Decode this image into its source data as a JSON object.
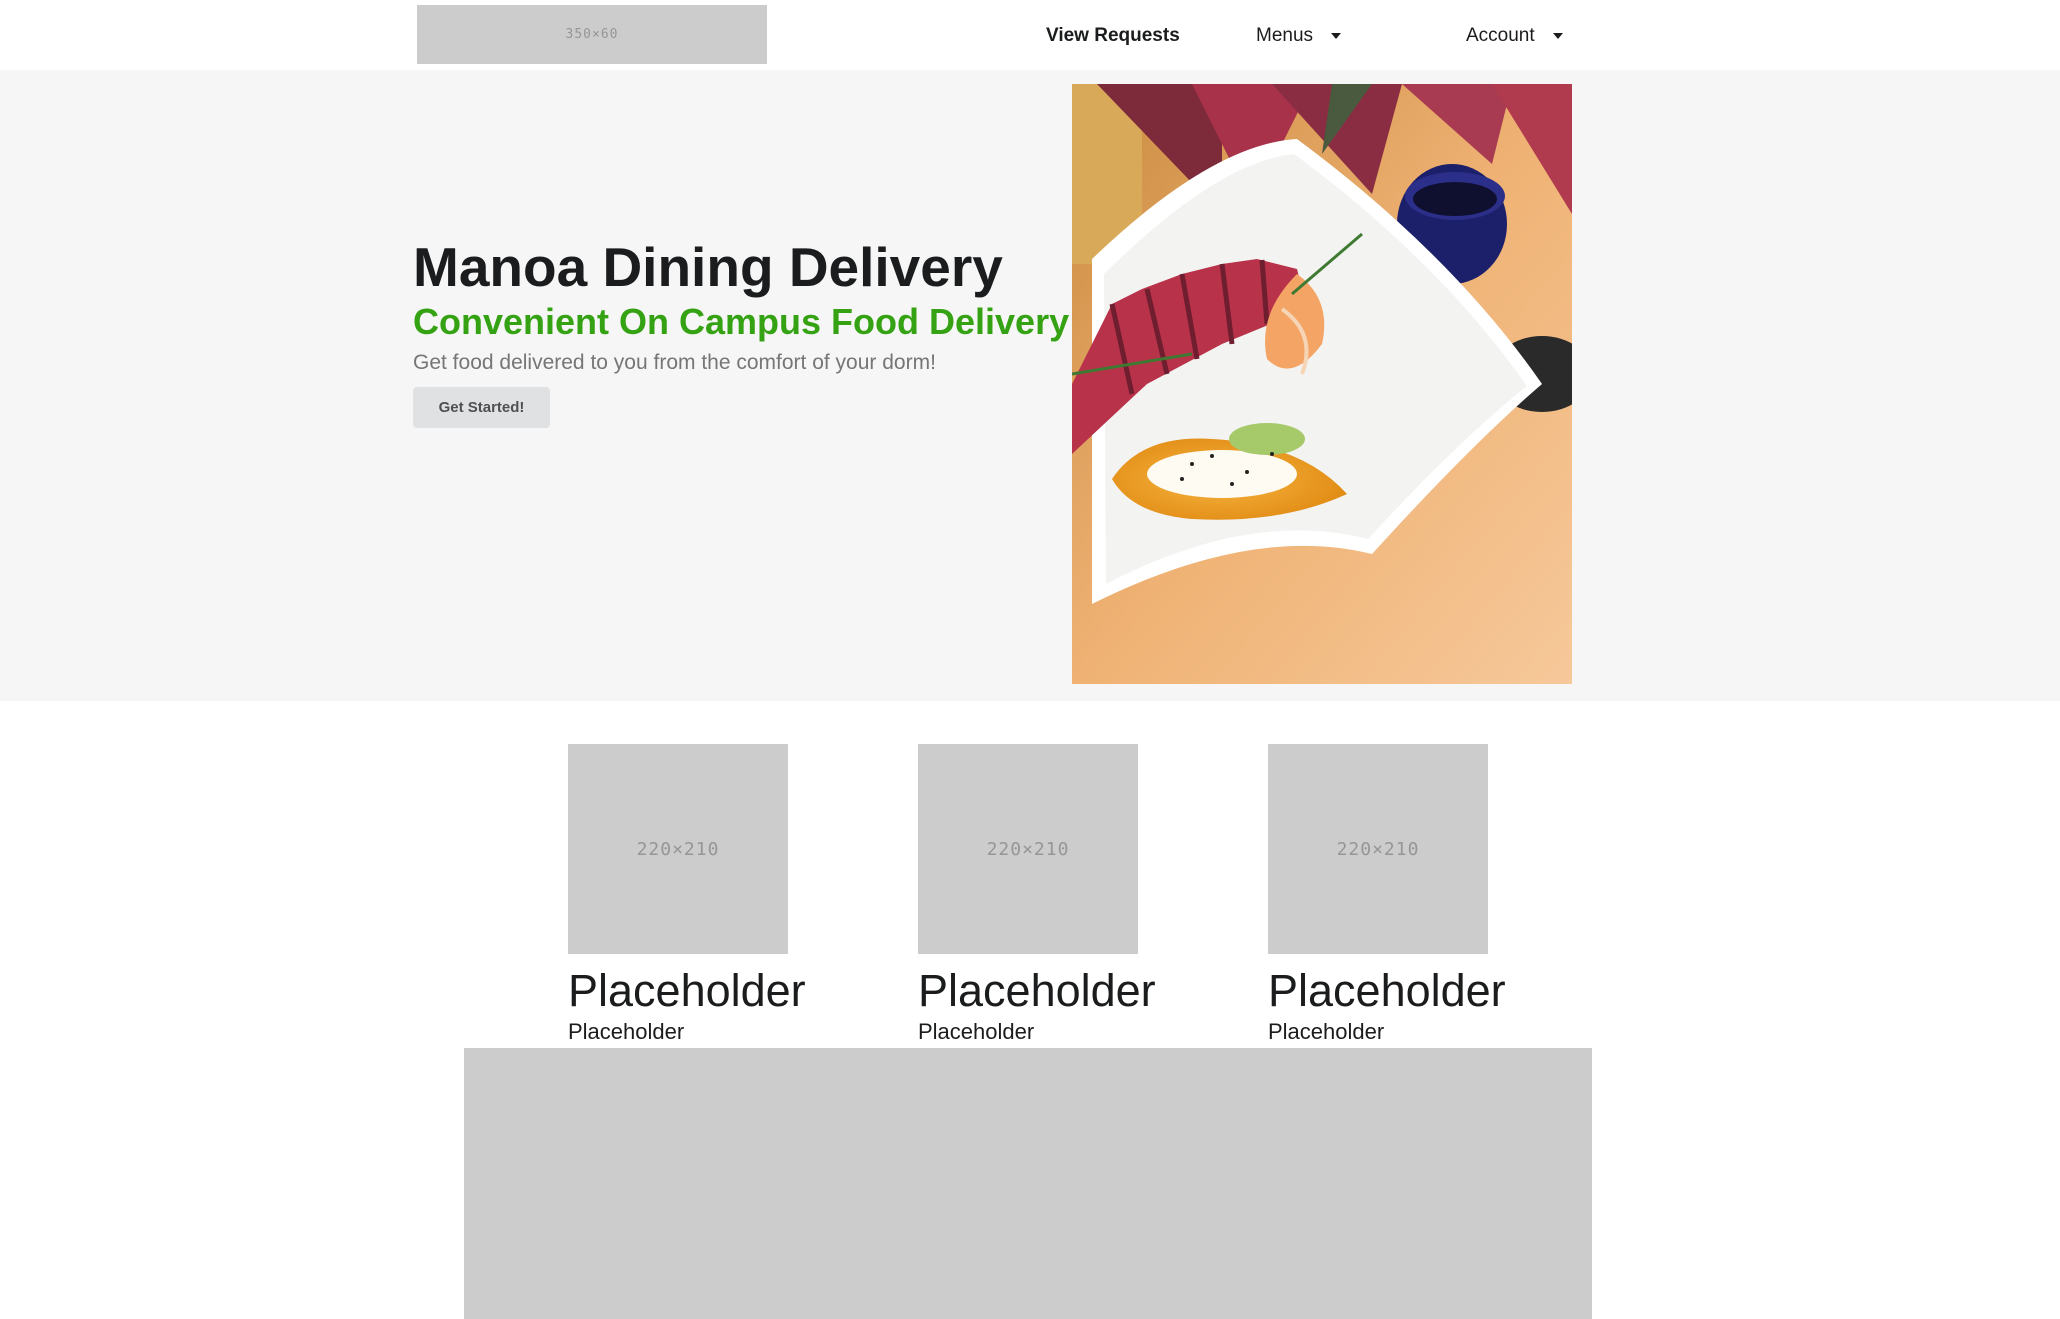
{
  "header": {
    "logo_placeholder": "350×60",
    "nav": [
      {
        "label": "View Requests"
      },
      {
        "label": "Menus"
      },
      {
        "label": "Account"
      }
    ]
  },
  "hero": {
    "title": "Manoa Dining Delivery",
    "subtitle": "Convenient On Campus Food Delivery",
    "text": "Get food delivered to you from the comfort of your dorm!",
    "button_label": "Get Started!",
    "subtitle_color": "#34a213"
  },
  "cards": [
    {
      "image_placeholder": "220×210",
      "title": "Placeholder",
      "subtitle": "Placeholder"
    },
    {
      "image_placeholder": "220×210",
      "title": "Placeholder",
      "subtitle": "Placeholder"
    },
    {
      "image_placeholder": "220×210",
      "title": "Placeholder",
      "subtitle": "Placeholder"
    }
  ]
}
